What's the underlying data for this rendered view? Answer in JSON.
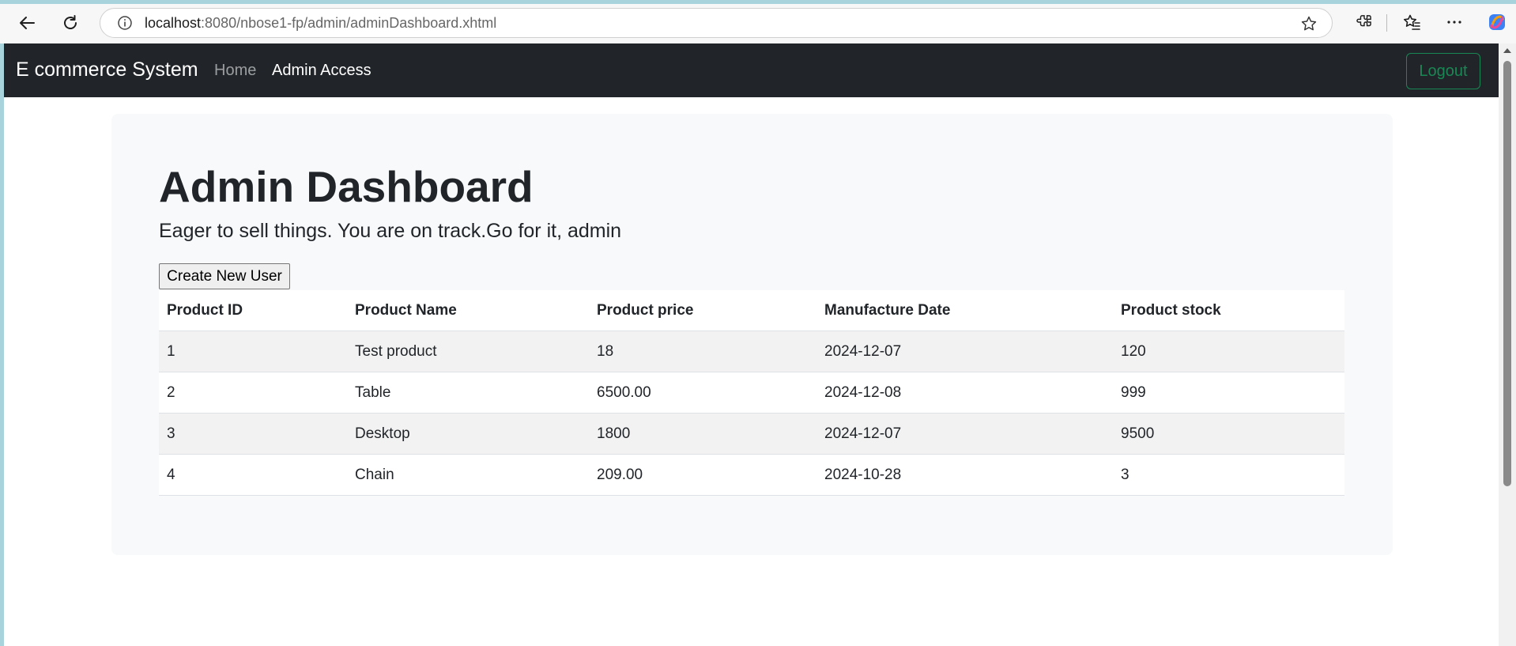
{
  "browser": {
    "url_host": "localhost",
    "url_rest": ":8080/nbose1-fp/admin/adminDashboard.xhtml"
  },
  "navbar": {
    "brand": "E commerce System",
    "links": [
      "Home",
      "Admin Access"
    ],
    "logout_label": "Logout"
  },
  "main": {
    "title": "Admin Dashboard",
    "lead": "Eager to sell things. You are on track.Go for it, admin",
    "create_button": "Create New User",
    "table": {
      "headers": [
        "Product ID",
        "Product Name",
        "Product price",
        "Manufacture Date",
        "Product stock"
      ],
      "rows": [
        [
          "1",
          "Test product",
          "18",
          "2024-12-07",
          "120"
        ],
        [
          "2",
          "Table",
          "6500.00",
          "2024-12-08",
          "999"
        ],
        [
          "3",
          "Desktop",
          "1800",
          "2024-12-07",
          "9500"
        ],
        [
          "4",
          "Chain",
          "209.00",
          "2024-10-28",
          "3"
        ]
      ]
    }
  },
  "colors": {
    "navbar_bg": "#212529",
    "logout_accent": "#198754",
    "card_bg": "#f8f9fa"
  }
}
